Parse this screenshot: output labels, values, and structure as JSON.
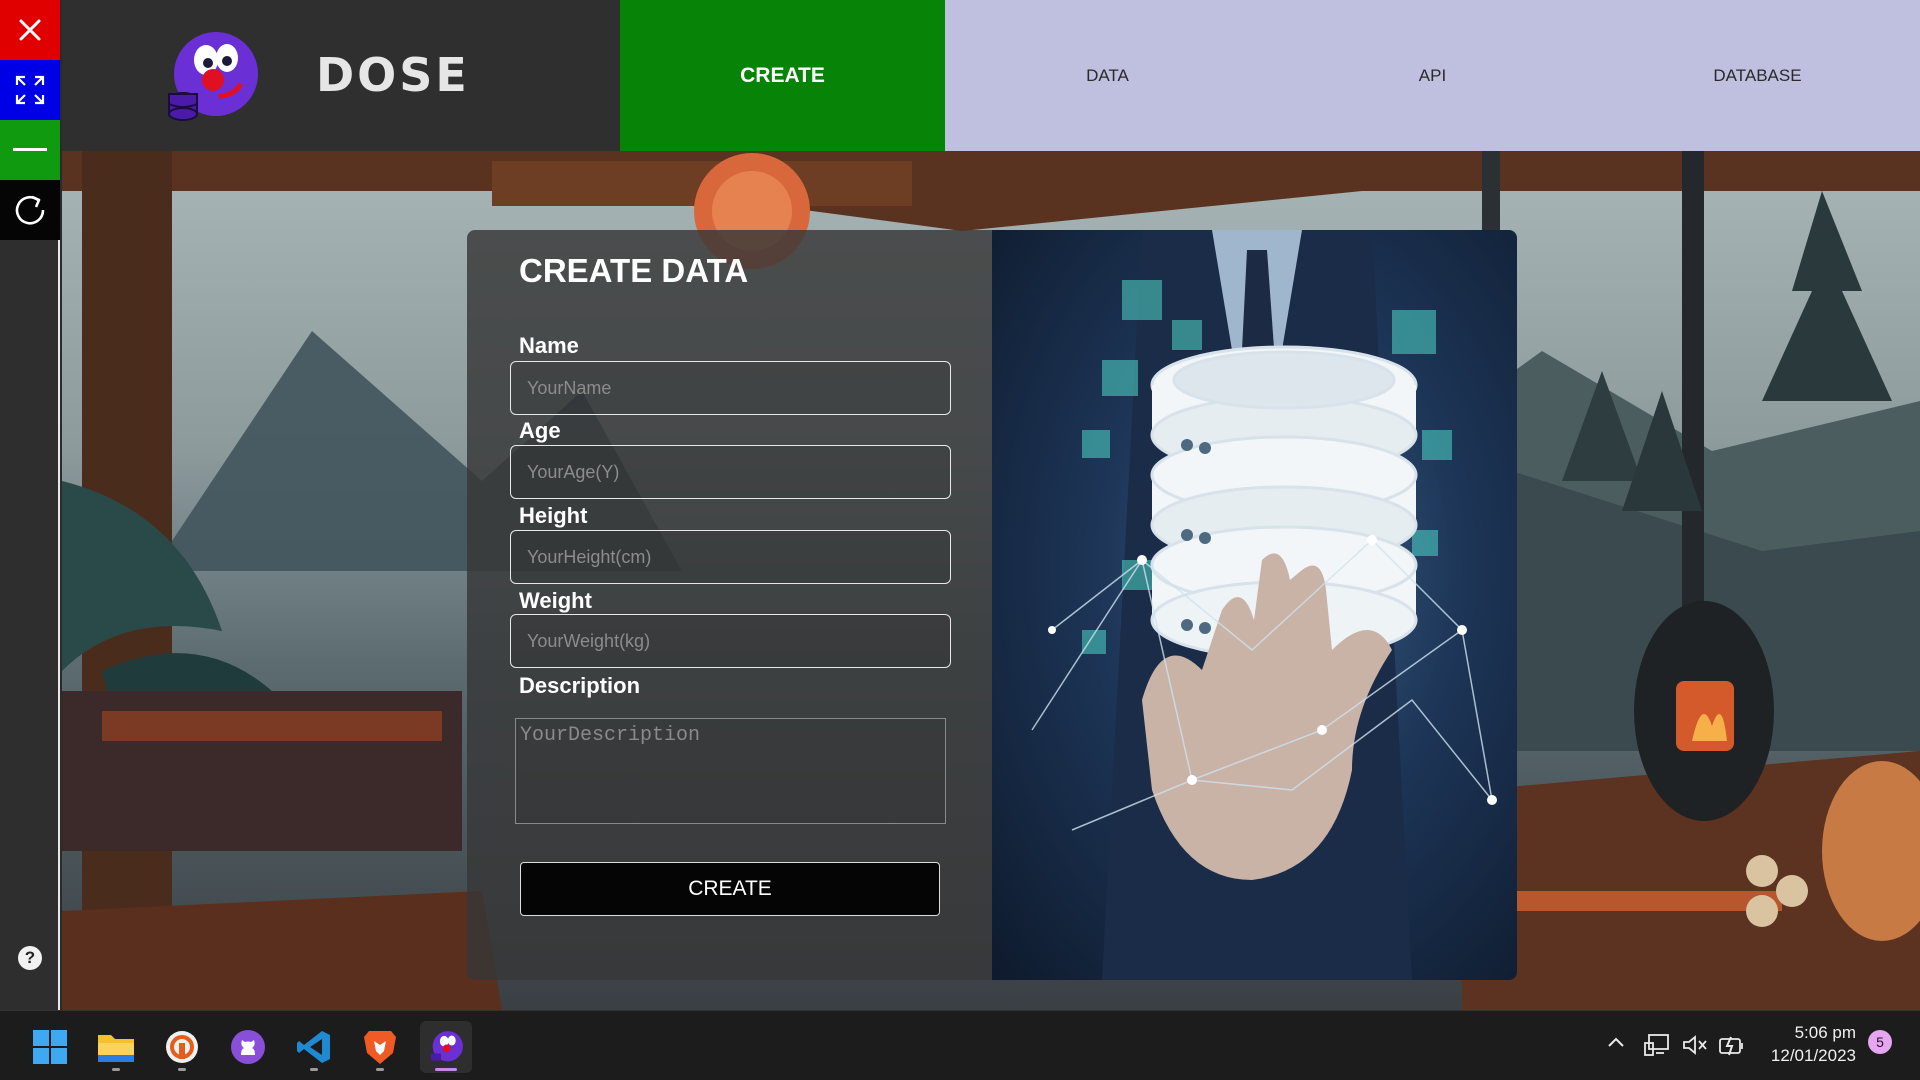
{
  "window_controls": {
    "close_icon": "close-icon",
    "maximize_icon": "expand-arrows-icon",
    "minimize_icon": "minus-icon",
    "reload_icon": "refresh-icon",
    "help_label": "?"
  },
  "brand": {
    "name": "DOSE",
    "logo_icon": "clown-mascot-icon"
  },
  "nav": {
    "items": [
      {
        "label": "CREATE",
        "active": true
      },
      {
        "label": "DATA",
        "active": false
      },
      {
        "label": "API",
        "active": false
      },
      {
        "label": "DATABASE",
        "active": false
      }
    ]
  },
  "form": {
    "title": "CREATE DATA",
    "fields": [
      {
        "label": "Name",
        "placeholder": "YourName",
        "value": ""
      },
      {
        "label": "Age",
        "placeholder": "YourAge(Y)",
        "value": ""
      },
      {
        "label": "Height",
        "placeholder": "YourHeight(cm)",
        "value": ""
      },
      {
        "label": "Weight",
        "placeholder": "YourWeight(kg)",
        "value": ""
      }
    ],
    "description": {
      "label": "Description",
      "placeholder": "YourDescription",
      "value": ""
    },
    "submit_label": "CREATE"
  },
  "hero_image": {
    "subject": "database-in-hand-icon"
  },
  "taskbar": {
    "apps": [
      {
        "name": "windows-start-icon"
      },
      {
        "name": "file-explorer-icon",
        "running": true
      },
      {
        "name": "ubuntu-app-icon",
        "running": true
      },
      {
        "name": "github-icon"
      },
      {
        "name": "vscode-icon",
        "running": true
      },
      {
        "name": "brave-browser-icon",
        "running": true
      },
      {
        "name": "dose-app-icon",
        "running": true,
        "active": true
      }
    ],
    "tray": {
      "chevron_icon": "chevron-up-icon",
      "network_icon": "network-icon",
      "volume_icon": "volume-muted-icon",
      "battery_icon": "battery-charging-icon"
    },
    "time": "5:06 pm",
    "date": "12/01/2023",
    "notification_count": "5"
  },
  "colors": {
    "close": "#e00000",
    "maximize": "#0000e6",
    "minimize": "#109a10",
    "nav_active": "#078307",
    "nav_inactive": "#bfbfdf",
    "brand_bg": "#2f2f2f"
  }
}
